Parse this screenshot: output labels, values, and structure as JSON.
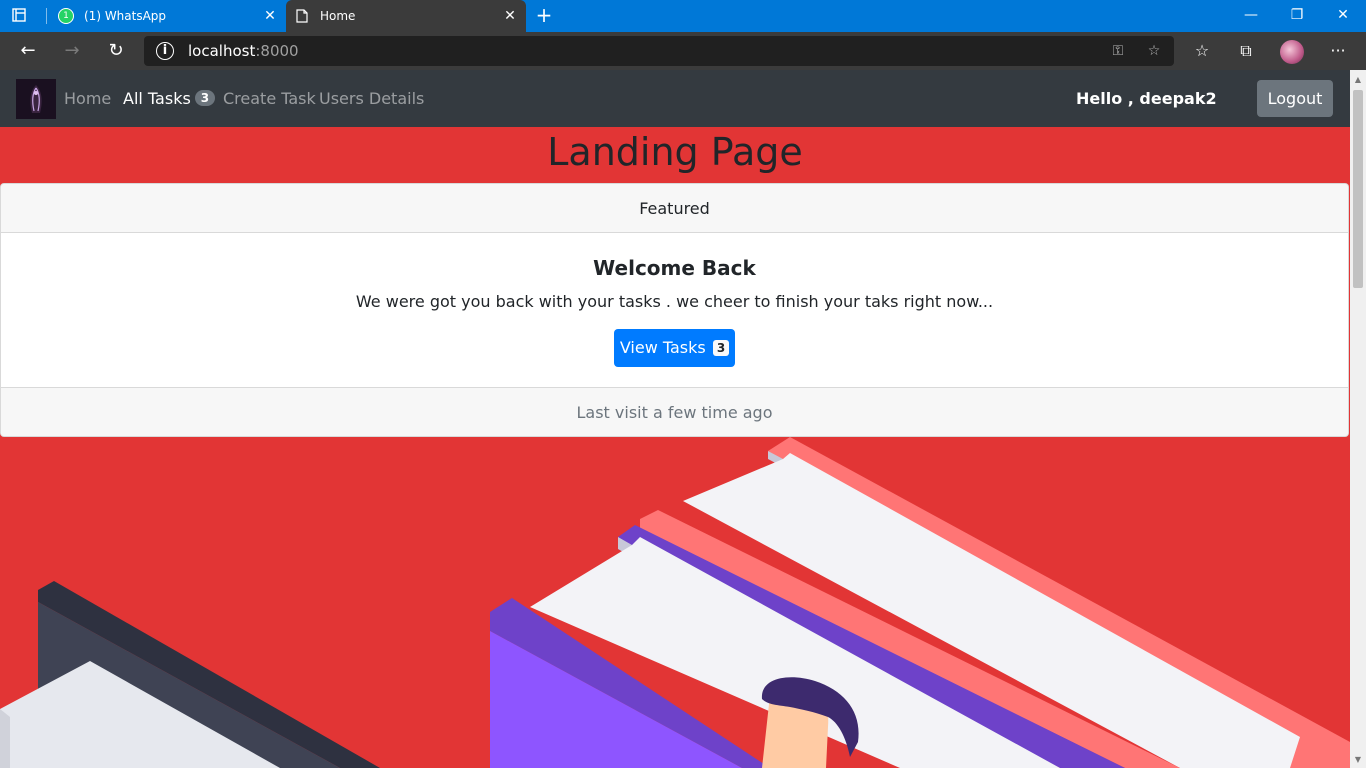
{
  "browser": {
    "tabs": [
      {
        "title": "(1) WhatsApp",
        "badge": "1"
      },
      {
        "title": "Home"
      }
    ],
    "url_host": "localhost",
    "url_port": ":8000"
  },
  "navbar": {
    "links": {
      "home": "Home",
      "all_tasks": "All Tasks",
      "all_tasks_count": "3",
      "create_task": "Create Task",
      "users_details": "Users Details"
    },
    "greeting": "Hello , deepak2",
    "logout_label": "Logout"
  },
  "page": {
    "heading": "Landing Page"
  },
  "card": {
    "header": "Featured",
    "title": "Welcome Back",
    "text": "We were got you back with your tasks . we cheer to finish your taks right now...",
    "button_label": "View Tasks",
    "button_count": "3",
    "footer": "Last visit a few time ago"
  },
  "colors": {
    "page_background": "#e23535",
    "navbar": "#343a40",
    "primary_button": "#007bff",
    "secondary_button": "#6c757d",
    "browser_accent": "#0078d7"
  },
  "icons": {
    "tab_actions": "tab-actions-icon",
    "whatsapp": "whatsapp-icon",
    "document": "document-icon",
    "back": "back-arrow-icon",
    "forward": "forward-arrow-icon",
    "refresh": "refresh-icon",
    "info": "info-icon",
    "key": "key-icon",
    "add_favorite": "add-favorite-icon",
    "favorites": "favorites-icon",
    "collections": "collections-icon",
    "more": "more-icon"
  }
}
